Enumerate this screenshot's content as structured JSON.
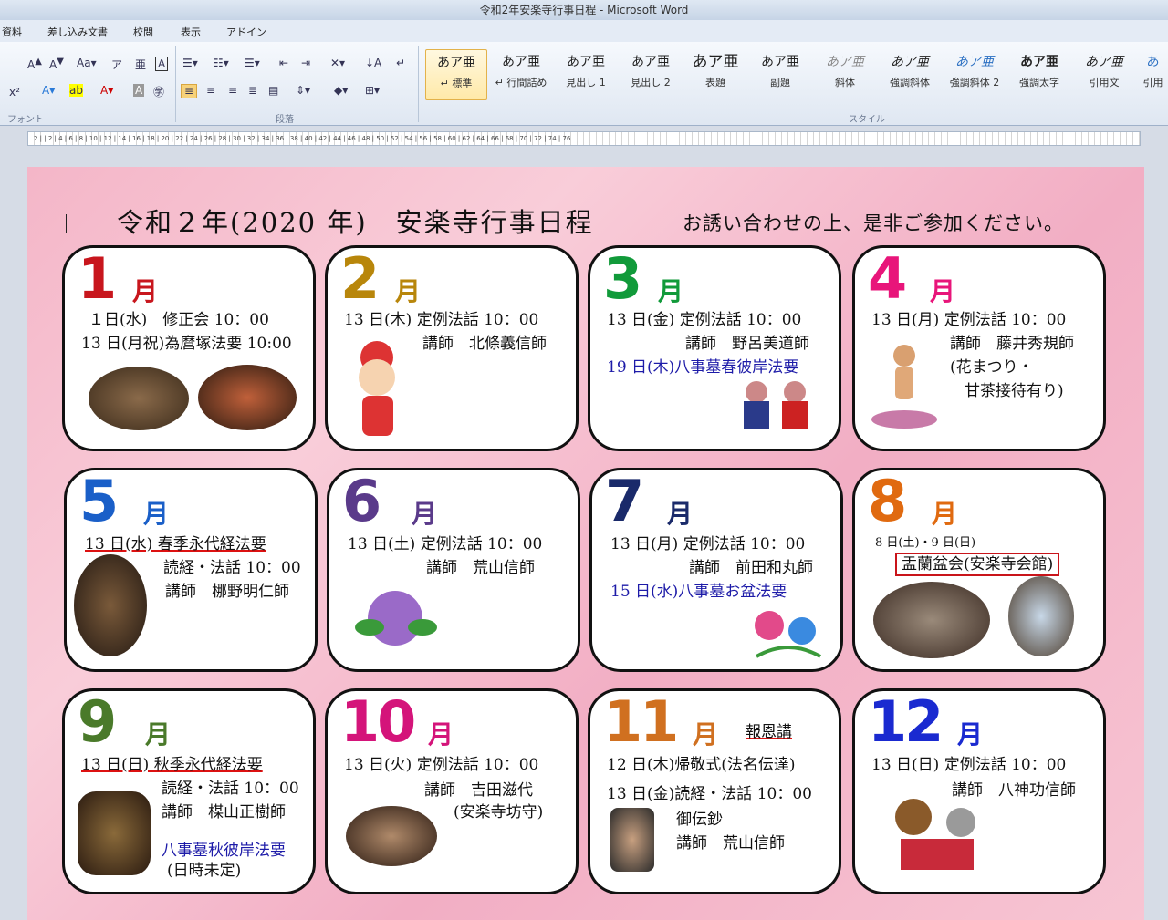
{
  "window": {
    "title": "令和2年安楽寺行事日程 - Microsoft Word"
  },
  "tabs": [
    "資料",
    "差し込み文書",
    "校閲",
    "表示",
    "アドイン"
  ],
  "ribbon": {
    "font_group": "フォント",
    "paragraph_group": "段落",
    "styles_group": "スタイル",
    "styles": [
      {
        "sample": "あア亜",
        "name": "↵ 標準"
      },
      {
        "sample": "あア亜",
        "name": "↵ 行間詰め"
      },
      {
        "sample": "あア亜",
        "name": "見出し 1"
      },
      {
        "sample": "あア亜",
        "name": "見出し 2"
      },
      {
        "sample": "あア亜",
        "name": "表題"
      },
      {
        "sample": "あア亜",
        "name": "副題"
      },
      {
        "sample": "あア亜",
        "name": "斜体"
      },
      {
        "sample": "あア亜",
        "name": "強調斜体"
      },
      {
        "sample": "あア亜",
        "name": "強調斜体 2"
      },
      {
        "sample": "あア亜",
        "name": "強調太字"
      },
      {
        "sample": "あア亜",
        "name": "引用文"
      },
      {
        "sample": "あ",
        "name": "引用"
      }
    ]
  },
  "ruler": {
    "numbers": "2 | | 2 | 4 | 6 | 8 | 10 | 12 | 14 | 16 | 18 | 20 | 22 | 24 | 26 | 28 | 30 | 32 | 34 | 36 | 38 | 40 | 42 | 44 | 46 | 48 | 50 | 52 | 54 | 56 | 58 | 60 | 62 | 64 | 66 | 68 | 70 | 72 | 74 | 76"
  },
  "doc": {
    "title": "令和２年(2020 年)　安楽寺行事日程",
    "subtitle": "お誘い合わせの上、是非ご参加ください。"
  },
  "months": [
    {
      "num": "1",
      "label": "月",
      "color": "#c8161d",
      "lines": [
        "１日(水)　修正会 10：00",
        "13 日(月祝)為麿塚法要 10:00"
      ]
    },
    {
      "num": "2",
      "label": "月",
      "color": "#b8860b",
      "lines": [
        "13 日(木) 定例法話 10：00",
        "講師　北條義信師"
      ]
    },
    {
      "num": "3",
      "label": "月",
      "color": "#119a3a",
      "lines": [
        "13 日(金) 定例法話 10：00",
        "講師　野呂美道師",
        "19 日(木)八事墓春彼岸法要"
      ]
    },
    {
      "num": "4",
      "label": "月",
      "color": "#e8157a",
      "lines": [
        "13 日(月) 定例法話 10：00",
        "講師　藤井秀規師",
        "(花まつり・",
        "甘茶接待有り)"
      ]
    },
    {
      "num": "5",
      "label": "月",
      "color": "#1a5fc8",
      "lines": [
        "13 日(水) 春季永代経法要",
        "読経・法話 10：00",
        "講師　梛野明仁師"
      ]
    },
    {
      "num": "6",
      "label": "月",
      "color": "#5a3a8a",
      "lines": [
        "13 日(土) 定例法話 10：00",
        "講師　荒山信師"
      ]
    },
    {
      "num": "7",
      "label": "月",
      "color": "#1a2a6a",
      "lines": [
        "13 日(月) 定例法話 10：00",
        "講師　前田和丸師",
        "15 日(水)八事墓お盆法要"
      ]
    },
    {
      "num": "8",
      "label": "月",
      "color": "#e06a10",
      "lines": [
        "8 日(土)・9 日(日)",
        "盂蘭盆会(安楽寺会館)"
      ]
    },
    {
      "num": "9",
      "label": "月",
      "color": "#4a7a2a",
      "lines": [
        "13 日(日) 秋季永代経法要",
        "読経・法話 10：00",
        "講師　楳山正樹師",
        "八事墓秋彼岸法要",
        "(日時未定)"
      ]
    },
    {
      "num": "10",
      "label": "月",
      "color": "#d4147a",
      "lines": [
        "13 日(火) 定例法話 10：00",
        "講師　吉田滋代",
        "(安楽寺坊守)"
      ]
    },
    {
      "num": "11",
      "label": "月",
      "color": "#d07020",
      "extra": "報恩講",
      "lines": [
        "12 日(木)帰敬式(法名伝達)",
        "13 日(金)読経・法話 10：00",
        "御伝鈔",
        "講師　荒山信師"
      ]
    },
    {
      "num": "12",
      "label": "月",
      "color": "#1a2ad0",
      "lines": [
        "13 日(日) 定例法話 10：00",
        "講師　八神功信師"
      ]
    }
  ]
}
